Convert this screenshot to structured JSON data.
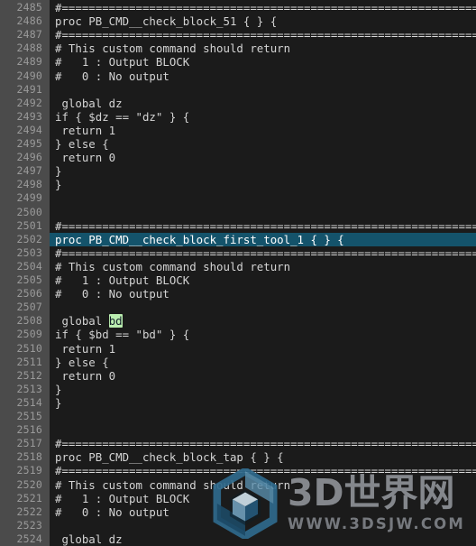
{
  "editor": {
    "theme": "dark",
    "background_color": "#1b1b1b",
    "gutter_color": "#4b4b4b",
    "line_number_color": "#9a9a9a",
    "text_color": "#d4d4d4",
    "current_line_highlight_color": "#14536b",
    "match_highlight_color": "#bbeeb0",
    "first_line_number": 2485,
    "last_line_number": 2524,
    "line_height_px": 15.1,
    "highlighted_line_number": 2502,
    "match_term": "bd"
  },
  "lines": [
    {
      "num": 2485,
      "text": "#=================================================================",
      "kind": "sep"
    },
    {
      "num": 2486,
      "text": "proc PB_CMD__check_block_51 { } {",
      "kind": "code"
    },
    {
      "num": 2487,
      "text": "#=================================================================",
      "kind": "sep"
    },
    {
      "num": 2488,
      "text": "# This custom command should return",
      "kind": "comment"
    },
    {
      "num": 2489,
      "text": "#   1 : Output BLOCK",
      "kind": "comment"
    },
    {
      "num": 2490,
      "text": "#   0 : No output",
      "kind": "comment"
    },
    {
      "num": 2491,
      "text": "",
      "kind": "code"
    },
    {
      "num": 2492,
      "text": " global dz",
      "kind": "code"
    },
    {
      "num": 2493,
      "text": "if { $dz == \"dz\" } {",
      "kind": "code"
    },
    {
      "num": 2494,
      "text": " return 1",
      "kind": "code"
    },
    {
      "num": 2495,
      "text": "} else {",
      "kind": "code"
    },
    {
      "num": 2496,
      "text": " return 0",
      "kind": "code"
    },
    {
      "num": 2497,
      "text": "}",
      "kind": "code"
    },
    {
      "num": 2498,
      "text": "}",
      "kind": "code"
    },
    {
      "num": 2499,
      "text": "",
      "kind": "code"
    },
    {
      "num": 2500,
      "text": "",
      "kind": "code"
    },
    {
      "num": 2501,
      "text": "#=================================================================",
      "kind": "sep"
    },
    {
      "num": 2502,
      "text": "proc PB_CMD__check_block_first_tool_1 { } {",
      "kind": "code",
      "current": true
    },
    {
      "num": 2503,
      "text": "#=================================================================",
      "kind": "sep"
    },
    {
      "num": 2504,
      "text": "# This custom command should return",
      "kind": "comment"
    },
    {
      "num": 2505,
      "text": "#   1 : Output BLOCK",
      "kind": "comment"
    },
    {
      "num": 2506,
      "text": "#   0 : No output",
      "kind": "comment"
    },
    {
      "num": 2507,
      "text": "",
      "kind": "code"
    },
    {
      "num": 2508,
      "text": " global bd",
      "kind": "code",
      "match": {
        "before": " global ",
        "term": "bd",
        "after": ""
      }
    },
    {
      "num": 2509,
      "text": "if { $bd == \"bd\" } {",
      "kind": "code"
    },
    {
      "num": 2510,
      "text": " return 1",
      "kind": "code"
    },
    {
      "num": 2511,
      "text": "} else {",
      "kind": "code"
    },
    {
      "num": 2512,
      "text": " return 0",
      "kind": "code"
    },
    {
      "num": 2513,
      "text": "}",
      "kind": "code"
    },
    {
      "num": 2514,
      "text": "}",
      "kind": "code"
    },
    {
      "num": 2515,
      "text": "",
      "kind": "code"
    },
    {
      "num": 2516,
      "text": "",
      "kind": "code"
    },
    {
      "num": 2517,
      "text": "#=================================================================",
      "kind": "sep"
    },
    {
      "num": 2518,
      "text": "proc PB_CMD__check_block_tap { } {",
      "kind": "code"
    },
    {
      "num": 2519,
      "text": "#=================================================================",
      "kind": "sep"
    },
    {
      "num": 2520,
      "text": "# This custom command should return",
      "kind": "comment"
    },
    {
      "num": 2521,
      "text": "#   1 : Output BLOCK",
      "kind": "comment"
    },
    {
      "num": 2522,
      "text": "#   0 : No output",
      "kind": "comment"
    },
    {
      "num": 2523,
      "text": "",
      "kind": "code"
    },
    {
      "num": 2524,
      "text": " global dz",
      "kind": "code"
    }
  ],
  "watermark": {
    "title": "3D世界网",
    "url": "WWW.3DSJW.COM",
    "logo_icon": "hexagon-cube-logo-icon",
    "title_color": "#8d9196",
    "url_color": "#7e8287",
    "logo_color_light": "#5b8fae",
    "logo_color_mid": "#2f6a8c",
    "logo_color_dark": "#1d4e6b"
  }
}
